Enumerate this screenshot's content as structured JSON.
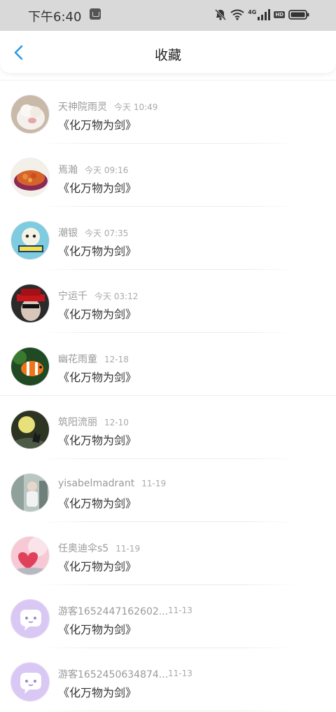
{
  "status_bar": {
    "time": "下午6:40",
    "network": "4G",
    "hd": "HD",
    "icons": [
      "app-notification-icon",
      "mute-bell-icon",
      "wifi-icon",
      "signal-icon",
      "battery-icon"
    ]
  },
  "nav": {
    "back_icon": "chevron-left-icon",
    "title": "收藏"
  },
  "colors": {
    "accent": "#2a9ae5",
    "status_bg": "#d9d9d9",
    "name_text": "#9a9a9a",
    "time_text": "#aaaaaa"
  },
  "items": [
    {
      "name": "天神院雨灵",
      "time": "今天 10:49",
      "content": "《化万物为剑》",
      "avatar": "white-cat-avatar"
    },
    {
      "name": "焉瀚",
      "time": "今天 09:16",
      "content": "《化万物为剑》",
      "avatar": "food-bowl-avatar"
    },
    {
      "name": "潮银",
      "time": "今天 07:35",
      "content": "《化万物为剑》",
      "avatar": "cartoon-avatar"
    },
    {
      "name": "宁运千",
      "time": "今天 03:12",
      "content": "《化万物为剑》",
      "avatar": "red-hat-avatar"
    },
    {
      "name": "幽花雨童",
      "time": "12-18",
      "content": "《化万物为剑》",
      "avatar": "clownfish-avatar"
    },
    {
      "name": "筑阳流丽",
      "time": "12-10",
      "content": "《化万物为剑》",
      "avatar": "moon-wolf-avatar"
    },
    {
      "name": "yisabelmadrant",
      "time": "11-19",
      "content": "《化万物为剑》",
      "avatar": "photo-avatar"
    },
    {
      "name": "任奥迪伞s5",
      "time": "11-19",
      "content": "《化万物为剑》",
      "avatar": "pink-hearts-avatar"
    },
    {
      "name": "游客1652447162602...",
      "time": "11-13",
      "content": "《化万物为剑》",
      "avatar": "default-chat-avatar"
    },
    {
      "name": "游客1652450634874...",
      "time": "11-13",
      "content": "《化万物为剑》",
      "avatar": "default-chat-avatar"
    }
  ]
}
